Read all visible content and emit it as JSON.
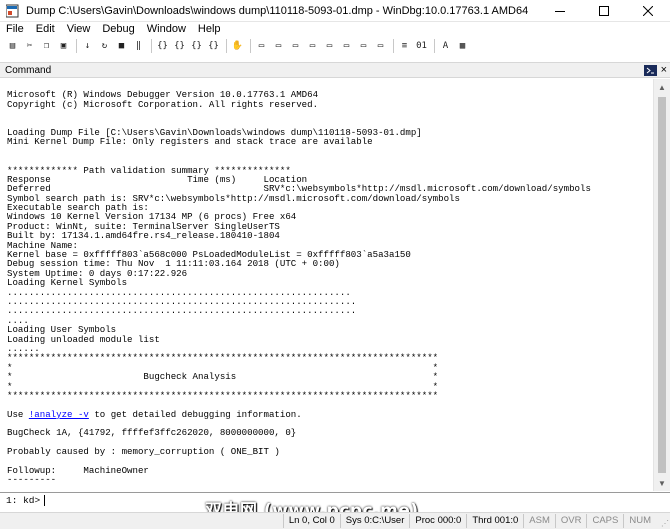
{
  "window": {
    "title": "Dump C:\\Users\\Gavin\\Downloads\\windows dump\\110118-5093-01.dmp - WinDbg:10.0.17763.1 AMD64",
    "controls": {
      "minimize": "minimize-icon",
      "maximize": "maximize-icon",
      "close": "close-icon"
    }
  },
  "menubar": {
    "items": [
      {
        "label": "File",
        "key": "file"
      },
      {
        "label": "Edit",
        "key": "edit"
      },
      {
        "label": "View",
        "key": "view"
      },
      {
        "label": "Debug",
        "key": "debug"
      },
      {
        "label": "Window",
        "key": "window"
      },
      {
        "label": "Help",
        "key": "help"
      }
    ]
  },
  "toolbar": {
    "groups": [
      [
        "open-icon",
        "cut-icon",
        "copy-icon",
        "paste-icon"
      ],
      [
        "go-icon",
        "restart-icon",
        "stop-debugging-icon",
        "break-icon"
      ],
      [
        "step-into-icon",
        "step-over-icon",
        "step-out-icon",
        "run-to-cursor-icon"
      ],
      [
        "source-mode-icon"
      ],
      [
        "command-window-icon",
        "watch-window-icon",
        "locals-window-icon",
        "registers-window-icon",
        "memory-window-icon",
        "call-stack-icon",
        "disassembly-icon",
        "scratch-pad-icon"
      ],
      [
        "source-mode-on-icon",
        "hex-display-icon"
      ],
      [
        "font-icon",
        "options-icon"
      ]
    ]
  },
  "command_pane": {
    "title": "Command",
    "icons": {
      "pane": "command-window-icon",
      "close": "close-icon"
    },
    "output": [
      "",
      "Microsoft (R) Windows Debugger Version 10.0.17763.1 AMD64",
      "Copyright (c) Microsoft Corporation. All rights reserved.",
      "",
      "",
      "Loading Dump File [C:\\Users\\Gavin\\Downloads\\windows dump\\110118-5093-01.dmp]",
      "Mini Kernel Dump File: Only registers and stack trace are available",
      "",
      "",
      "************* Path validation summary **************",
      "Response                         Time (ms)     Location",
      "Deferred                                       SRV*c:\\websymbols*http://msdl.microsoft.com/download/symbols",
      "Symbol search path is: SRV*c:\\websymbols*http://msdl.microsoft.com/download/symbols",
      "Executable search path is:",
      "Windows 10 Kernel Version 17134 MP (6 procs) Free x64",
      "Product: WinNt, suite: TerminalServer SingleUserTS",
      "Built by: 17134.1.amd64fre.rs4_release.180410-1804",
      "Machine Name:",
      "Kernel base = 0xfffff803`a568c000 PsLoadedModuleList = 0xfffff803`a5a3a150",
      "Debug session time: Thu Nov  1 11:11:03.164 2018 (UTC + 0:00)",
      "System Uptime: 0 days 0:17:22.926",
      "Loading Kernel Symbols",
      "...............................................................",
      "................................................................",
      "................................................................",
      "....",
      "Loading User Symbols",
      "Loading unloaded module list",
      "......",
      "*******************************************************************************",
      "*                                                                             *",
      "*                        Bugcheck Analysis                                    *",
      "*                                                                             *",
      "*******************************************************************************",
      "",
      "Use !analyze -v to get detailed debugging information.",
      "",
      "BugCheck 1A, {41792, ffffef3ffc262020, 8000000000, 0}",
      "",
      "Probably caused by : memory_corruption ( ONE_BIT )",
      "",
      "Followup:     MachineOwner",
      "---------",
      ""
    ],
    "analyze_link": "!analyze -v",
    "analyze_prefix": "Use ",
    "analyze_suffix": " to get detailed debugging information."
  },
  "command_input": {
    "prompt": "1: kd>",
    "value": ""
  },
  "watermark": "双电网 (www.pcpc.me)",
  "statusbar": {
    "cells": [
      {
        "label": "Ln 0, Col 0",
        "dim": false
      },
      {
        "label": "Sys 0:C:\\User",
        "dim": false
      },
      {
        "label": "Proc 000:0",
        "dim": false
      },
      {
        "label": "Thrd 001:0",
        "dim": false
      },
      {
        "label": "ASM",
        "dim": true
      },
      {
        "label": "OVR",
        "dim": true
      },
      {
        "label": "CAPS",
        "dim": true
      },
      {
        "label": "NUM",
        "dim": true
      }
    ]
  }
}
